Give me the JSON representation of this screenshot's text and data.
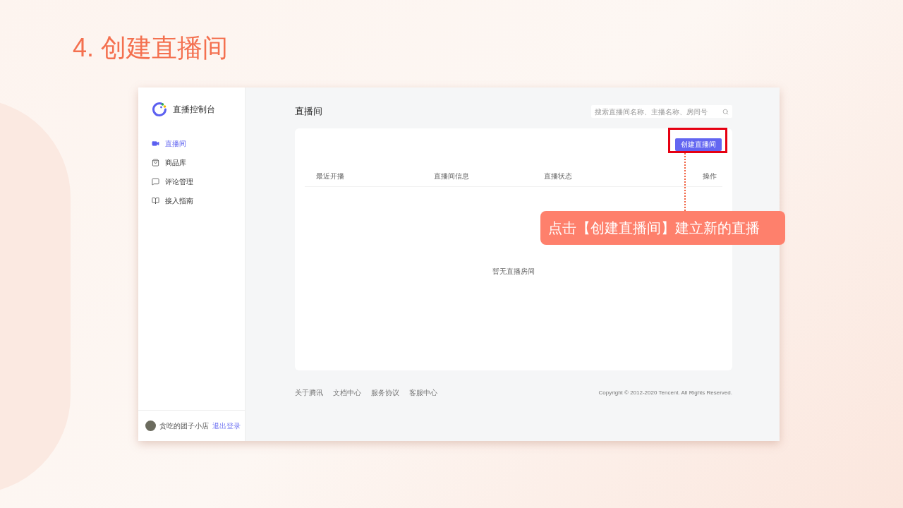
{
  "slide": {
    "title": "4. 创建直播间"
  },
  "app": {
    "brand": "直播控制台",
    "nav": [
      {
        "label": "直播间",
        "selected": true
      },
      {
        "label": "商品库",
        "selected": false
      },
      {
        "label": "评论管理",
        "selected": false
      },
      {
        "label": "接入指南",
        "selected": false
      }
    ],
    "user": {
      "name": "贪吃的团子小店",
      "logout": "退出登录"
    },
    "page_title": "直播间",
    "search": {
      "placeholder": "搜索直播间名称、主播名称、房间号"
    },
    "create_button": "创建直播间",
    "table": {
      "columns": [
        "最近开播",
        "直播间信息",
        "直播状态",
        "操作"
      ],
      "empty_text": "暂无直播房间"
    },
    "footer": {
      "links": [
        "关于腾讯",
        "文档中心",
        "服务协议",
        "客服中心"
      ],
      "copyright": "Copyright © 2012-2020 Tencent. All Rights Reserved."
    }
  },
  "annotation": {
    "callout": "点击【创建直播间】建立新的直播"
  }
}
